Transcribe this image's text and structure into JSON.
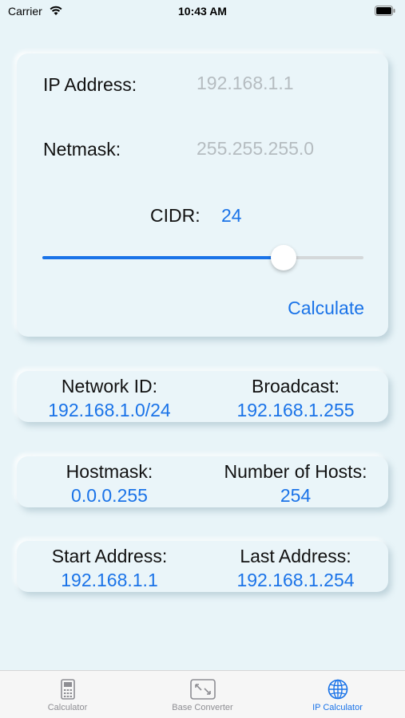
{
  "status_bar": {
    "carrier": "Carrier",
    "time": "10:43 AM"
  },
  "input": {
    "ip_label": "IP Address:",
    "ip_placeholder": "192.168.1.1",
    "netmask_label": "Netmask:",
    "netmask_placeholder": "255.255.255.0",
    "cidr_label": "CIDR:",
    "cidr_value": "24",
    "cidr_max": 32,
    "calculate_label": "Calculate"
  },
  "results": {
    "network_id_label": "Network ID:",
    "network_id_value": "192.168.1.0/24",
    "broadcast_label": "Broadcast:",
    "broadcast_value": "192.168.1.255",
    "hostmask_label": "Hostmask:",
    "hostmask_value": "0.0.0.255",
    "hosts_label": "Number of Hosts:",
    "hosts_value": "254",
    "start_label": "Start Address:",
    "start_value": "192.168.1.1",
    "last_label": "Last Address:",
    "last_value": "192.168.1.254"
  },
  "tabs": [
    {
      "label": "Calculator",
      "icon": "calculator-icon",
      "active": false
    },
    {
      "label": "Base Converter",
      "icon": "base-converter-icon",
      "active": false
    },
    {
      "label": "IP Calculator",
      "icon": "globe-icon",
      "active": true
    }
  ],
  "colors": {
    "accent": "#1a73e8",
    "background": "#e8f4f8"
  }
}
